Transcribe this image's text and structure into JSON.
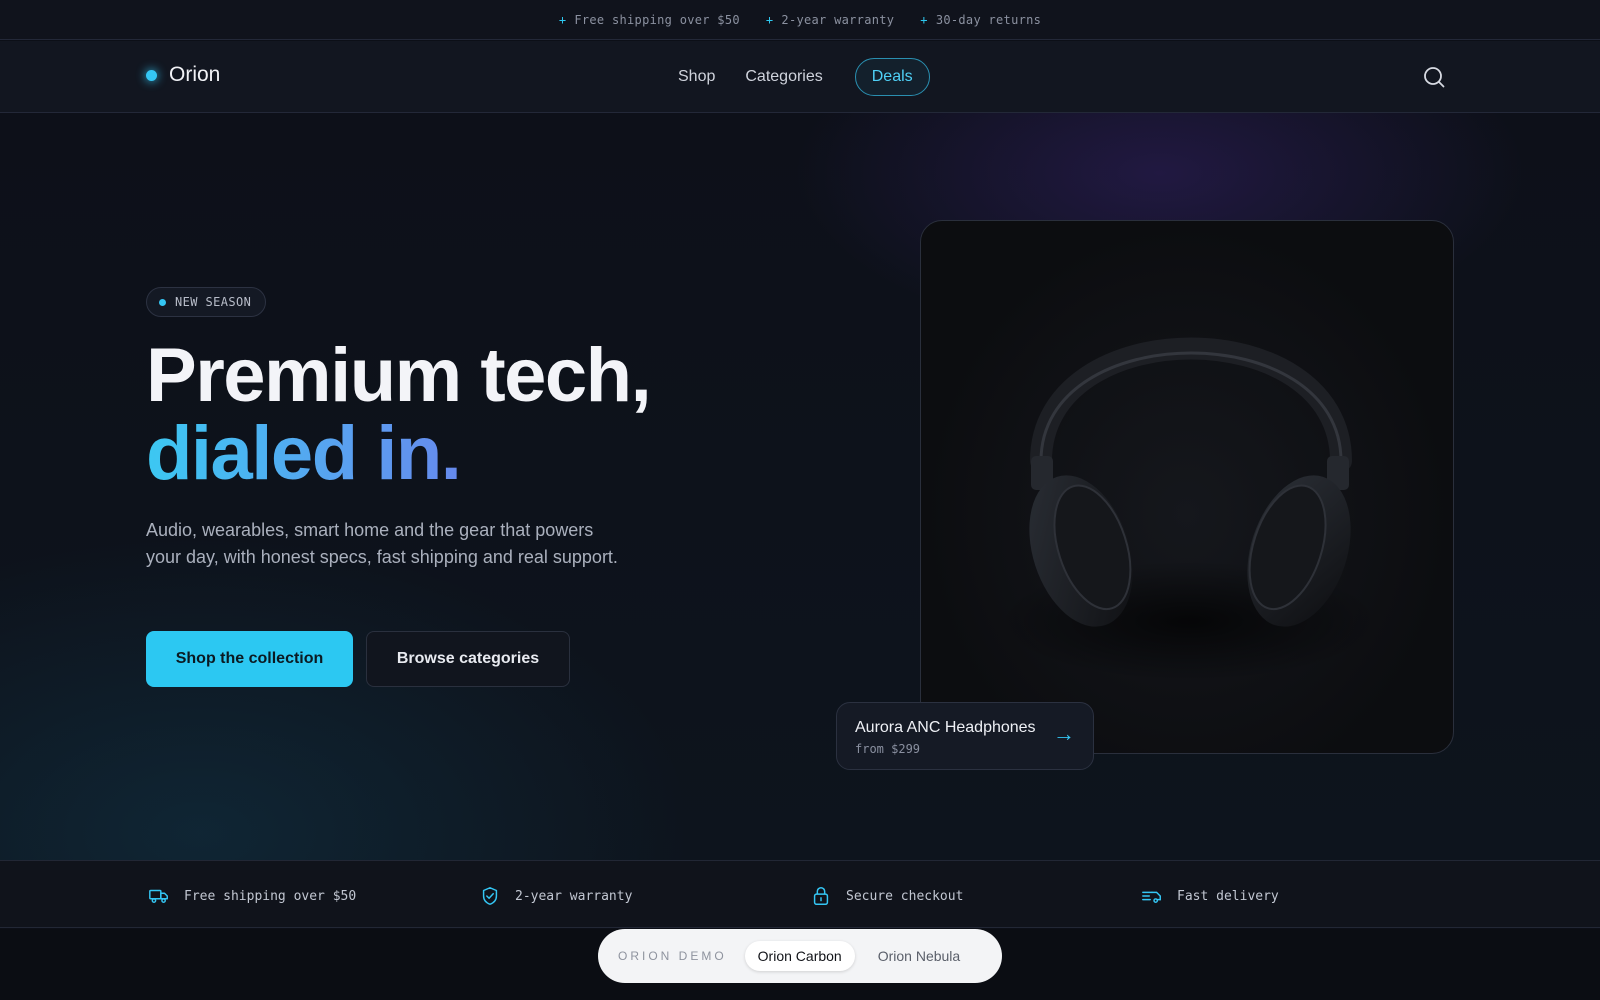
{
  "announcement": {
    "items": [
      {
        "icon": "plus-icon",
        "text": "Free shipping over $50"
      },
      {
        "icon": "plus-icon",
        "text": "2-year warranty"
      },
      {
        "icon": "plus-icon",
        "text": "30-day returns"
      }
    ]
  },
  "nav": {
    "brand": "Orion",
    "links": [
      "Shop",
      "Categories",
      "Deals"
    ],
    "search_icon": "search-icon"
  },
  "hero": {
    "badge": "NEW SEASON",
    "headline_line1": "Premium tech,",
    "headline_line2": "dialed in.",
    "subcopy": "Audio, wearables, smart home and the gear that powers your day, with honest specs, fast shipping and real support.",
    "primary_cta": "Shop the collection",
    "secondary_cta": "Browse categories",
    "product": {
      "name": "Aurora ANC Headphones",
      "price": "from $299",
      "arrow": "→"
    }
  },
  "features": [
    {
      "icon": "truck-icon",
      "text": "Free shipping over $50"
    },
    {
      "icon": "shield-check-icon",
      "text": "2-year warranty"
    },
    {
      "icon": "lock-icon",
      "text": "Secure checkout"
    },
    {
      "icon": "fast-delivery-icon",
      "text": "Fast delivery"
    }
  ],
  "demo_switcher": {
    "label": "ORION DEMO",
    "options": [
      "Orion Carbon",
      "Orion Nebula"
    ],
    "active": "Orion Carbon"
  },
  "colors": {
    "accent": "#2cc8f2",
    "gradient_end": "#7a63e8",
    "background": "#0c0f17"
  }
}
